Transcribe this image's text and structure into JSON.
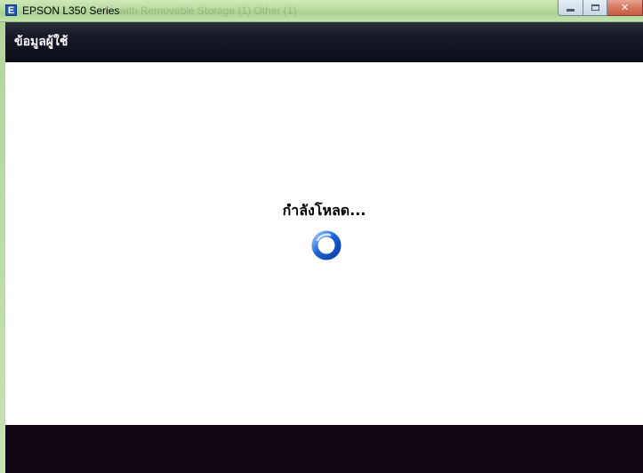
{
  "window": {
    "title": "EPSON L350 Series",
    "icon_letter": "E",
    "ghost_text": "... with Removable Storage (1)     Other (1)",
    "controls": {
      "minimize": "minimize-icon",
      "maximize": "maximize-icon",
      "close": "close-icon"
    }
  },
  "header": {
    "title": "ข้อมูลผู้ใช้"
  },
  "content": {
    "loading_text": "กำลังโหลด...",
    "spinner_icon": "loading-spinner-icon"
  },
  "colors": {
    "titlebar": "#b9dca0",
    "header_bg": "#0a0d17",
    "footer_bg": "#120514",
    "spinner_blue": "#1c63d8"
  }
}
